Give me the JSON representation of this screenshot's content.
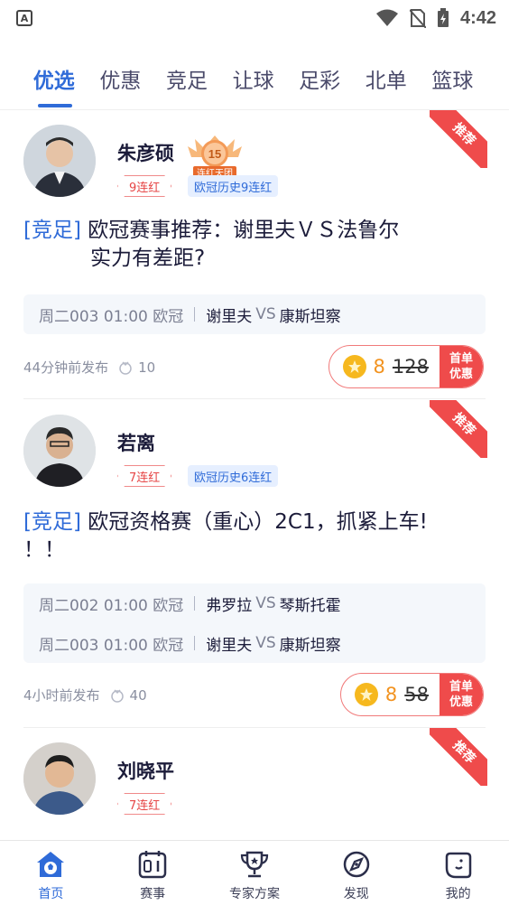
{
  "status_bar": {
    "time": "4:42",
    "app_icon_letter": "A"
  },
  "tabs": [
    {
      "label": "优选",
      "active": true
    },
    {
      "label": "优惠",
      "active": false
    },
    {
      "label": "竞足",
      "active": false
    },
    {
      "label": "让球",
      "active": false
    },
    {
      "label": "足彩",
      "active": false
    },
    {
      "label": "北单",
      "active": false
    },
    {
      "label": "篮球",
      "active": false
    }
  ],
  "ribbon_label": "推荐",
  "cards": [
    {
      "expert_name": "朱彦硕",
      "streak": "9连红",
      "history": "欧冠历史9连红",
      "medal": {
        "number": "15",
        "caption": "连红天团"
      },
      "tag": "[竞足]",
      "title_line1": "欧冠赛事推荐：谢里夫ＶＳ法鲁尔",
      "title_line2": "实力有差距?",
      "matches": [
        {
          "info": "周二003 01:00 欧冠",
          "home": "谢里夫",
          "vs": "VS",
          "away": "康斯坦察"
        }
      ],
      "published": "44分钟前发布",
      "views": "10",
      "price": "8",
      "original_price": "128",
      "deal_line1": "首单",
      "deal_line2": "优惠"
    },
    {
      "expert_name": "若离",
      "streak": "7连红",
      "history": "欧冠历史6连红",
      "tag": "[竞足]",
      "title_line1": "欧冠资格赛（重心）2C1，抓紧上车!",
      "title_line2": "！！",
      "matches": [
        {
          "info": "周二002 01:00 欧冠",
          "home": "弗罗拉",
          "vs": "VS",
          "away": "琴斯托霍"
        },
        {
          "info": "周二003 01:00 欧冠",
          "home": "谢里夫",
          "vs": "VS",
          "away": "康斯坦察"
        }
      ],
      "published": "4小时前发布",
      "views": "40",
      "price": "8",
      "original_price": "58",
      "deal_line1": "首单",
      "deal_line2": "优惠"
    },
    {
      "expert_name": "刘晓平",
      "streak": "7连红"
    }
  ],
  "bottom_nav": [
    {
      "label": "首页",
      "icon": "home-football-icon",
      "active": true
    },
    {
      "label": "赛事",
      "icon": "scoreboard-icon",
      "active": false
    },
    {
      "label": "专家方案",
      "icon": "trophy-icon",
      "active": false
    },
    {
      "label": "发现",
      "icon": "compass-icon",
      "active": false
    },
    {
      "label": "我的",
      "icon": "profile-face-icon",
      "active": false
    }
  ],
  "colors": {
    "accent": "#2f6bd8",
    "red": "#ef4b4b",
    "coin": "#f6b81e",
    "price": "#f29320"
  }
}
